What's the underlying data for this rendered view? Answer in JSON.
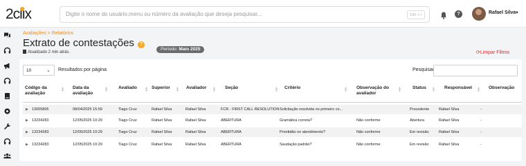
{
  "app": {
    "logo": "2clix"
  },
  "search": {
    "placeholder": "Digite o nome do usuário,menu ou número da avaliação que deseja pesquisar...",
    "shortcut": "Ctrl + /"
  },
  "user": {
    "name": "Rafael Silva"
  },
  "header": {
    "help_label": "?"
  },
  "sidebar": {
    "icons": [
      "chat-icon",
      "headset-icon",
      "megaphone-icon",
      "headset-icon",
      "book-icon",
      "gear-icon",
      "wrench-icon",
      "headset-icon",
      "users-icon"
    ]
  },
  "page": {
    "breadcrumb": "Avaliações  >  Relatórios",
    "title": "Extrato de contestações",
    "info_label": "?",
    "period_label": "Período:",
    "period_value": "Maio 2025",
    "updated": "Atualizado 2 min atrás.",
    "clear_filters": "Limpar Filtros"
  },
  "table": {
    "page_size": "10",
    "per_page_label": "Resultados por página",
    "search_label": "Pesquisar",
    "columns": [
      "Código da avaliação",
      "Data da avaliação",
      "Avaliado",
      "Superior",
      "Avaliador",
      "Seção",
      "Critério",
      "Observação do avaliador",
      "Status",
      "Responsável",
      "Observação"
    ],
    "rows": [
      [
        "13005805",
        "08/04/2025 15:59",
        "Tiago Cruz",
        "Rafael Silva",
        "Rafael Silva",
        "FCR - FIRST CALL RESOLUTION",
        "Solicitação resolvida no primeiro co...",
        "",
        "Procedente",
        "Rafael Silva",
        "-"
      ],
      [
        "13234283",
        "12/05/2025 10:29",
        "Tiago Cruz",
        "Rafael Silva",
        "Rafael Silva",
        "ABERTURA",
        "Gramática correta?",
        "Não conforme",
        "Abertura",
        "Rafael Silva",
        "-"
      ],
      [
        "13234283",
        "12/05/2025 10:29",
        "Tiago Cruz",
        "Rafael Silva",
        "Rafael Silva",
        "ABERTURA",
        "Prontidão no atendimento?",
        "Não conforme",
        "Em revisão",
        "Rafael Silva",
        "-"
      ],
      [
        "13234283",
        "12/05/2025 10:29",
        "Tiago Cruz",
        "Rafael Silva",
        "Rafael Silva",
        "ABERTURA",
        "Saudação padrão?",
        "Não conforme",
        "Em revisão",
        "Rafael Silva",
        "-"
      ]
    ]
  },
  "colors": {
    "accent": "#f08c1a",
    "danger": "#e0282e",
    "badge": "#6b6b6b"
  }
}
